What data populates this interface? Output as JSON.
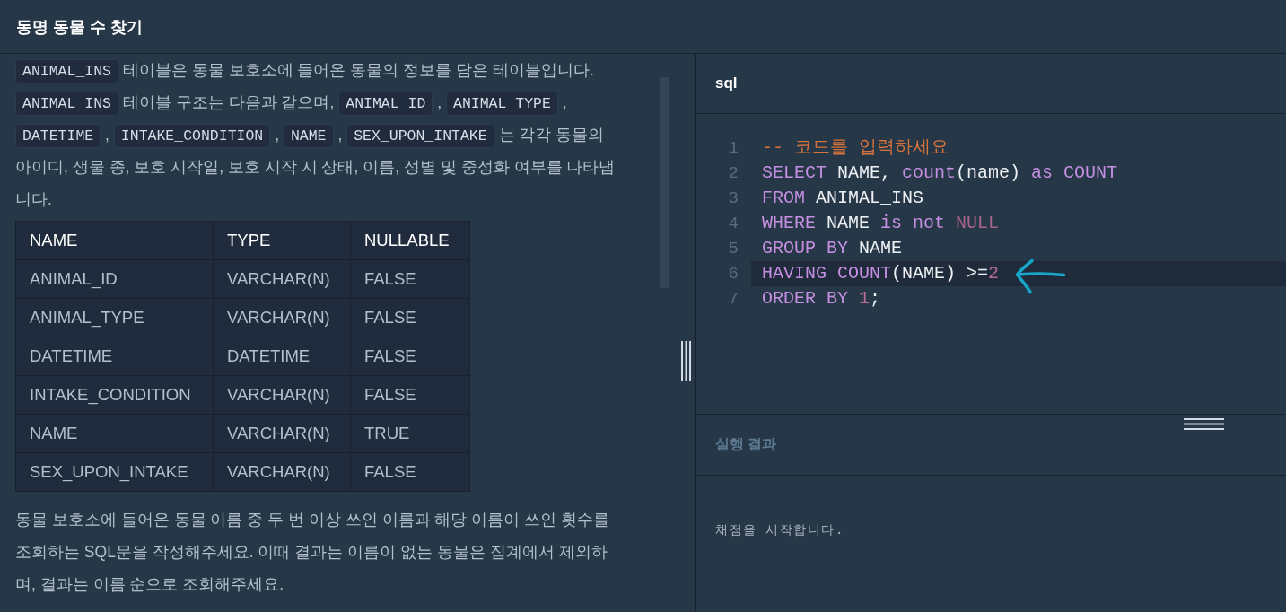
{
  "header": {
    "title": "동명 동물 수 찾기"
  },
  "description": {
    "paragraphs": [
      {
        "segments": [
          {
            "kind": "code",
            "text": "ANIMAL_INS"
          },
          {
            "kind": "text",
            "text": "테이블은 동물 보호소에 들어온 동물의 정보를 담은 테이블입니다."
          }
        ]
      },
      {
        "segments": [
          {
            "kind": "code",
            "text": "ANIMAL_INS"
          },
          {
            "kind": "text",
            "text": "테이블 구조는 다음과 같으며,"
          },
          {
            "kind": "code",
            "text": "ANIMAL_ID"
          },
          {
            "kind": "text",
            "text": ","
          },
          {
            "kind": "code",
            "text": "ANIMAL_TYPE"
          },
          {
            "kind": "text",
            "text": ","
          },
          {
            "kind": "code",
            "text": "DATETIME"
          },
          {
            "kind": "text",
            "text": ","
          },
          {
            "kind": "code",
            "text": "INTAKE_CONDITION"
          },
          {
            "kind": "text",
            "text": ","
          },
          {
            "kind": "code",
            "text": "NAME"
          },
          {
            "kind": "text",
            "text": ","
          },
          {
            "kind": "code",
            "text": "SEX_UPON_INTAKE"
          },
          {
            "kind": "text",
            "text": "는 각각 동물의"
          },
          {
            "kind": "text_block",
            "text": "아이디, 생물 종, 보호 시작일, 보호 시작 시 상태, 이름, 성별 및 중성화 여부를 나타냅니다."
          }
        ]
      }
    ]
  },
  "table": {
    "columns": [
      "NAME",
      "TYPE",
      "NULLABLE"
    ],
    "rows": [
      [
        "ANIMAL_ID",
        "VARCHAR(N)",
        "FALSE"
      ],
      [
        "ANIMAL_TYPE",
        "VARCHAR(N)",
        "FALSE"
      ],
      [
        "DATETIME",
        "DATETIME",
        "FALSE"
      ],
      [
        "INTAKE_CONDITION",
        "VARCHAR(N)",
        "FALSE"
      ],
      [
        "NAME",
        "VARCHAR(N)",
        "TRUE"
      ],
      [
        "SEX_UPON_INTAKE",
        "VARCHAR(N)",
        "FALSE"
      ]
    ]
  },
  "task": {
    "text": "동물 보호소에 들어온 동물 이름 중 두 번 이상 쓰인 이름과 해당 이름이 쓰인 횟수를 조회하는 SQL문을 작성해주세요. 이때 결과는 이름이 없는 동물은 집계에서 제외하며, 결과는 이름 순으로 조회해주세요."
  },
  "editor": {
    "tab": "sql",
    "lines": [
      {
        "number": "1",
        "active": false,
        "tokens": [
          {
            "kind": "comment",
            "text": "-- 코드를 입력하세요"
          }
        ]
      },
      {
        "number": "2",
        "active": false,
        "tokens": [
          {
            "kind": "keyword",
            "text": "SELECT"
          },
          {
            "kind": "plain",
            "text": " NAME, "
          },
          {
            "kind": "keyword",
            "text": "count"
          },
          {
            "kind": "plain",
            "text": "(name) "
          },
          {
            "kind": "keyword",
            "text": "as COUNT"
          }
        ]
      },
      {
        "number": "3",
        "active": false,
        "tokens": [
          {
            "kind": "keyword",
            "text": "FROM"
          },
          {
            "kind": "plain",
            "text": " ANIMAL_INS"
          }
        ]
      },
      {
        "number": "4",
        "active": false,
        "tokens": [
          {
            "kind": "keyword",
            "text": "WHERE"
          },
          {
            "kind": "plain",
            "text": " NAME "
          },
          {
            "kind": "keyword",
            "text": "is not "
          },
          {
            "kind": "constant",
            "text": "NULL"
          }
        ]
      },
      {
        "number": "5",
        "active": false,
        "tokens": [
          {
            "kind": "keyword",
            "text": "GROUP BY"
          },
          {
            "kind": "plain",
            "text": " NAME"
          }
        ]
      },
      {
        "number": "6",
        "active": true,
        "tokens": [
          {
            "kind": "keyword",
            "text": "HAVING COUNT"
          },
          {
            "kind": "plain",
            "text": "(NAME) >="
          },
          {
            "kind": "number",
            "text": "2"
          }
        ]
      },
      {
        "number": "7",
        "active": false,
        "tokens": [
          {
            "kind": "keyword",
            "text": "ORDER BY "
          },
          {
            "kind": "number",
            "text": "1"
          },
          {
            "kind": "plain",
            "text": ";"
          }
        ]
      }
    ]
  },
  "result": {
    "title": "실행 결과",
    "output": "채점을 시작합니다."
  }
}
